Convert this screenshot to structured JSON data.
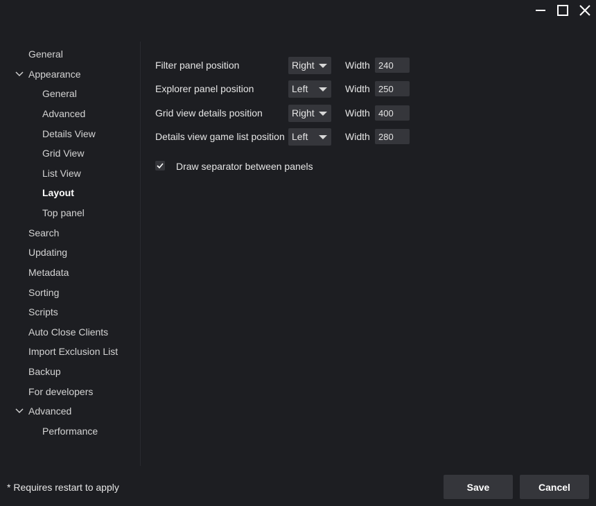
{
  "window": {
    "minimize_icon": "minimize-icon",
    "maximize_icon": "maximize-icon",
    "close_icon": "close-icon"
  },
  "sidebar": {
    "items": [
      {
        "label": "General",
        "level": 0
      },
      {
        "label": "Appearance",
        "level": 0,
        "expanded": true
      },
      {
        "label": "General",
        "level": 1
      },
      {
        "label": "Advanced",
        "level": 1
      },
      {
        "label": "Details View",
        "level": 1
      },
      {
        "label": "Grid View",
        "level": 1
      },
      {
        "label": "List View",
        "level": 1
      },
      {
        "label": "Layout",
        "level": 1,
        "selected": true
      },
      {
        "label": "Top panel",
        "level": 1
      },
      {
        "label": "Search",
        "level": 0
      },
      {
        "label": "Updating",
        "level": 0
      },
      {
        "label": "Metadata",
        "level": 0
      },
      {
        "label": "Sorting",
        "level": 0
      },
      {
        "label": "Scripts",
        "level": 0
      },
      {
        "label": "Auto Close Clients",
        "level": 0
      },
      {
        "label": "Import Exclusion List",
        "level": 0
      },
      {
        "label": "Backup",
        "level": 0
      },
      {
        "label": "For developers",
        "level": 0
      },
      {
        "label": "Advanced",
        "level": 0,
        "expanded": true
      },
      {
        "label": "Performance",
        "level": 1
      }
    ]
  },
  "layout": {
    "rows": [
      {
        "label": "Filter panel position",
        "position": "Right",
        "width_label": "Width",
        "width": "240"
      },
      {
        "label": "Explorer panel position",
        "position": "Left",
        "width_label": "Width",
        "width": "250"
      },
      {
        "label": "Grid view details position",
        "position": "Right",
        "width_label": "Width",
        "width": "400"
      },
      {
        "label": "Details view game list position",
        "position": "Left",
        "width_label": "Width",
        "width": "280"
      }
    ],
    "separator": {
      "label": "Draw separator between panels",
      "checked": true
    }
  },
  "footer": {
    "note": "* Requires restart to apply",
    "save_label": "Save",
    "cancel_label": "Cancel"
  },
  "colors": {
    "background": "#1d1e22",
    "control": "#35363b",
    "text": "#e6e6e6"
  }
}
